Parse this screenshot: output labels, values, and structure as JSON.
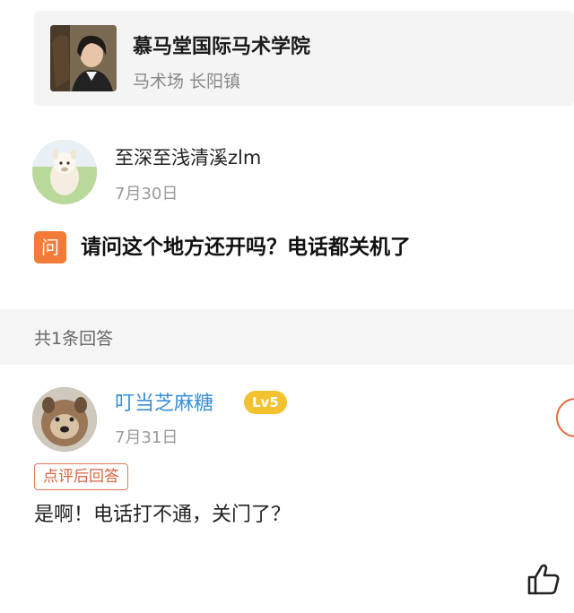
{
  "merchant": {
    "name": "慕马堂国际马术学院",
    "location": "马术场 长阳镇"
  },
  "question": {
    "asker_name": "至深至浅清溪zlm",
    "date": "7月30日",
    "badge": "问",
    "text": "请问这个地方还开吗？电话都关机了"
  },
  "answers": {
    "count_label": "共1条回答",
    "items": [
      {
        "name": "叮当芝麻糖",
        "level": "Lv5",
        "date": "7月31日",
        "tag": "点评后回答",
        "text": "是啊！电话打不通，关门了？"
      }
    ]
  },
  "icons": {
    "like": "thumbs-up-icon",
    "side": "floating-circle-button"
  },
  "colors": {
    "accent_orange": "#f27b3a",
    "name_blue": "#3a8fd6",
    "level_gold": "#f2c230",
    "tag_border": "#e07a5f"
  }
}
